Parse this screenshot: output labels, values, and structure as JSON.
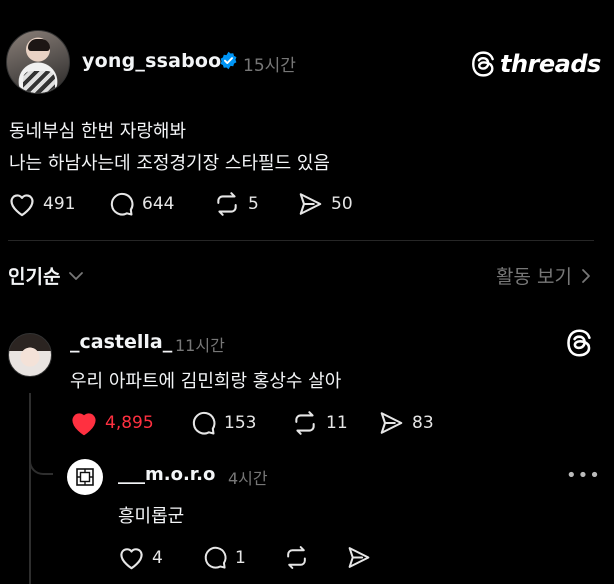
{
  "post": {
    "username": "yong_ssaboo",
    "time": "15시간",
    "brand": "threads",
    "text_line1": "동네부심 한번 자랑해봐",
    "text_line2": "나는 하남사는데 조정경기장 스타필드 있음",
    "likes": "491",
    "comments": "644",
    "reposts": "5",
    "shares": "50"
  },
  "replies_header": {
    "sort_label": "인기순",
    "activity_label": "활동 보기"
  },
  "comment1": {
    "username": "_castella_",
    "time": "11시간",
    "text": "우리 아파트에 김민희랑 홍상수 살아",
    "likes": "4,895",
    "comments": "153",
    "reposts": "11",
    "shares": "83"
  },
  "comment2": {
    "username": "___m.o.r.o",
    "time": "4시간",
    "text": "흥미롭군",
    "likes": "4",
    "comments": "1"
  },
  "colors": {
    "background": "#000000",
    "text": "#f3f5f7",
    "muted": "#777777",
    "verified": "#0095f6",
    "like_red": "#ff3040"
  },
  "icons": [
    "heart-icon",
    "comment-icon",
    "repost-icon",
    "share-icon",
    "verified-badge-icon",
    "threads-logo-icon",
    "chevron-down-icon",
    "chevron-right-icon",
    "more-icon"
  ]
}
